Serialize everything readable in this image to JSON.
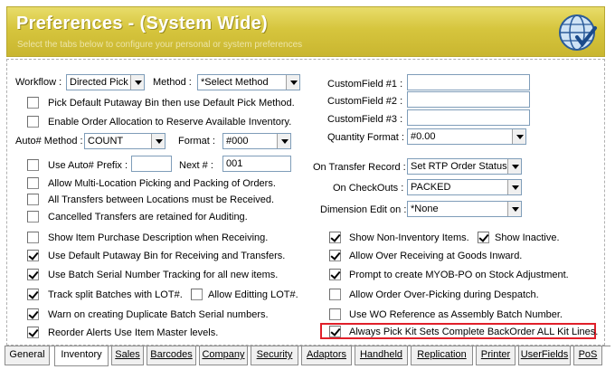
{
  "header": {
    "title": "Preferences - (System Wide)",
    "subtitle": "Select the tabs below to configure your personal or system preferences"
  },
  "left": {
    "workflow_label": "Workflow :",
    "workflow_value": "Directed Pick",
    "method_label": "Method :",
    "method_value": "*Select Method",
    "chk_default_putaway": "Pick Default Putaway Bin then use Default Pick Method.",
    "chk_order_allocation": "Enable Order Allocation to Reserve Available Inventory.",
    "auto_method_label": "Auto# Method :",
    "auto_method_value": "COUNT",
    "format_label": "Format :",
    "format_value": "#000",
    "chk_use_auto_prefix": "Use Auto# Prefix :",
    "prefix_value": "",
    "next_label": "Next # :",
    "next_value": "001",
    "chk_multi_location": "Allow Multi-Location Picking and Packing of Orders.",
    "chk_transfers_received": "All Transfers between Locations must be Received.",
    "chk_cancelled_transfers": "Cancelled Transfers are retained for Auditing.",
    "chk_show_item_desc": "Show Item Purchase Description when Receiving.",
    "chk_default_putaway_bin": "Use Default Putaway Bin for Receiving and Transfers.",
    "chk_batch_serial": "Use Batch Serial Number Tracking for all new items.",
    "chk_track_split": "Track split Batches with LOT#.",
    "chk_allow_edit_lot": "Allow Editting LOT#.",
    "chk_warn_duplicate": "Warn on creating Duplicate Batch Serial numbers.",
    "chk_reorder_alerts": "Reorder Alerts Use Item Master levels."
  },
  "right": {
    "cf1_label": "CustomField #1 :",
    "cf2_label": "CustomField #2 :",
    "cf3_label": "CustomField #3 :",
    "cf1_value": "",
    "cf2_value": "",
    "cf3_value": "",
    "qty_format_label": "Quantity Format :",
    "qty_format_value": "#0.00",
    "on_transfer_label": "On Transfer Record :",
    "on_transfer_value": "Set RTP Order Status",
    "on_checkouts_label": "On CheckOuts :",
    "on_checkouts_value": "PACKED",
    "dimension_label": "Dimension Edit on :",
    "dimension_value": "*None",
    "chk_show_non_inventory": "Show Non-Inventory Items.",
    "chk_show_inactive": "Show Inactive.",
    "chk_over_receiving": "Allow Over Receiving at Goods Inward.",
    "chk_prompt_myob": "Prompt to create MYOB-PO on Stock Adjustment.",
    "chk_over_picking": "Allow Order Over-Picking during Despatch.",
    "chk_wo_reference": "Use WO Reference as Assembly Batch Number.",
    "chk_always_pick_kit": "Always Pick Kit Sets Complete BackOrder ALL Kit Lines."
  },
  "tabs": {
    "general": "General",
    "inventory": "Inventory",
    "sales": "Sales",
    "barcodes": "Barcodes",
    "company": "Company",
    "security": "Security",
    "adaptors": "Adaptors",
    "handheld": "Handheld",
    "replication": "Replication",
    "printer": "Printer",
    "userfields": "UserFields",
    "pos": "PoS"
  },
  "colors": {
    "header_gold": "#d6c53d",
    "highlight_red": "#e0202a"
  }
}
